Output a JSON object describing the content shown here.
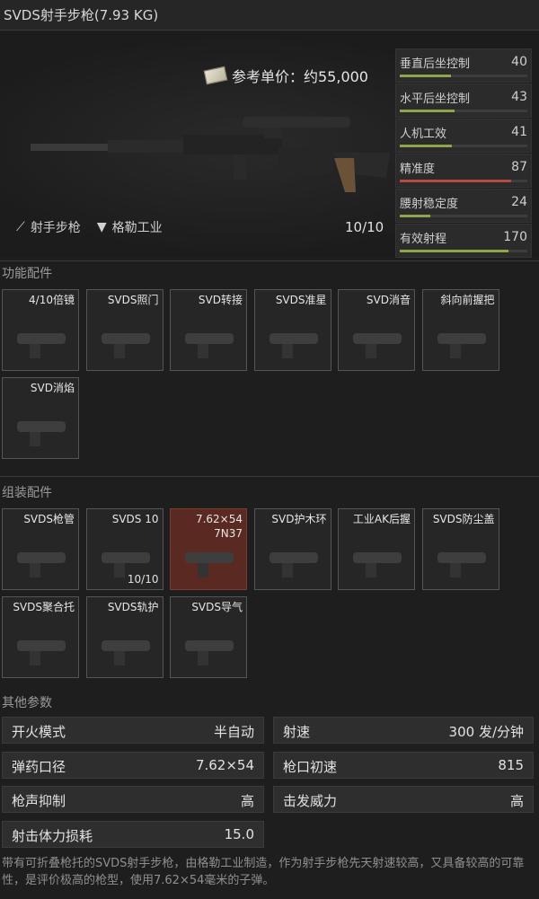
{
  "title": "SVDS射手步枪(7.93 KG)",
  "price": {
    "label": "参考单价：约55,000",
    "icon": "money-icon"
  },
  "weapon": {
    "type_label": "射手步枪",
    "type_icon": "rifle-type-icon",
    "maker_label": "格勒工业",
    "maker_icon": "maker-logo-icon",
    "ammo": "10/10"
  },
  "stats": [
    {
      "label": "垂直后坐控制",
      "value": "40",
      "fill": 0.4,
      "color": "#8da54b"
    },
    {
      "label": "水平后坐控制",
      "value": "43",
      "fill": 0.43,
      "color": "#8da54b"
    },
    {
      "label": "人机工效",
      "value": "41",
      "fill": 0.41,
      "color": "#8da54b"
    },
    {
      "label": "精准度",
      "value": "87",
      "fill": 0.87,
      "color": "#b54a3f"
    },
    {
      "label": "腰射稳定度",
      "value": "24",
      "fill": 0.24,
      "color": "#8da54b"
    },
    {
      "label": "有效射程",
      "value": "170",
      "fill": 0.85,
      "color": "#8da54b"
    }
  ],
  "sections": {
    "functional": "功能配件",
    "assembly": "组装配件",
    "other": "其他参数"
  },
  "functional_slots": [
    {
      "label": "4/10倍镜"
    },
    {
      "label": "SVDS照门"
    },
    {
      "label": "SVD转接"
    },
    {
      "label": "SVDS准星"
    },
    {
      "label": "SVD消音"
    },
    {
      "label": "斜向前握把"
    },
    {
      "label": "SVD消焰"
    }
  ],
  "assembly_slots": [
    {
      "label": "SVDS枪管"
    },
    {
      "label": "SVDS 10",
      "sub": "10/10"
    },
    {
      "label": "7.62×54",
      "sub2": "7N37",
      "highlight": true
    },
    {
      "label": "SVD护木环"
    },
    {
      "label": "工业AK后握"
    },
    {
      "label": "SVDS防尘盖"
    },
    {
      "label": "SVDS聚合托"
    },
    {
      "label": "SVDS轨护"
    },
    {
      "label": "SVDS导气"
    }
  ],
  "params": [
    {
      "label": "开火模式",
      "value": "半自动"
    },
    {
      "label": "射速",
      "value": "300 发/分钟"
    },
    {
      "label": "弹药口径",
      "value": "7.62×54"
    },
    {
      "label": "枪口初速",
      "value": "815"
    },
    {
      "label": "枪声抑制",
      "value": "高"
    },
    {
      "label": "击发威力",
      "value": "高"
    },
    {
      "label": "射击体力损耗",
      "value": "15.0"
    }
  ],
  "description": "带有可折叠枪托的SVDS射手步枪，由格勒工业制造，作为射手步枪先天射速较高，又具备较高的可靠性，是评价极高的枪型，使用7.62×54毫米的子弹。"
}
